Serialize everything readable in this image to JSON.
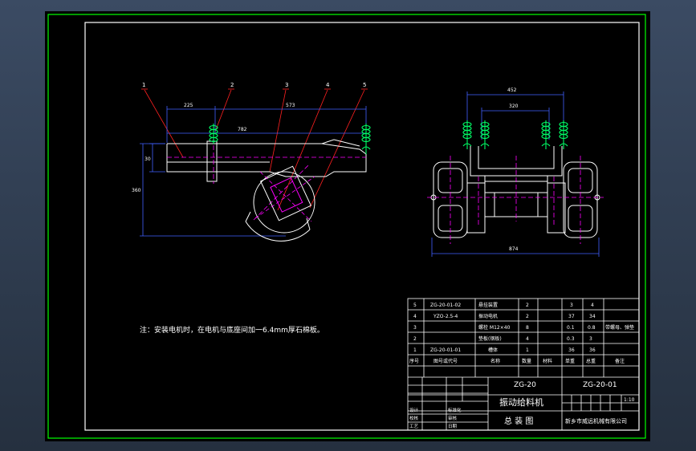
{
  "colors": {
    "background": "#000000",
    "frame_green": "#00ff00",
    "border_white": "#ffffff",
    "dimension_blue": "#4060ff",
    "leader_red": "#ff2020",
    "center_magenta": "#ff00ff",
    "spring_green": "#00ff66",
    "note_yellow": "#ffff00"
  },
  "drawing": {
    "side_view": {
      "part_labels": [
        "1",
        "2",
        "3",
        "4",
        "5"
      ],
      "dimensions": [
        "225",
        "573",
        "782",
        "30",
        "360"
      ]
    },
    "front_view": {
      "dimensions": [
        "452",
        "320",
        "874"
      ]
    },
    "note": "注：安装电机时，在电机与底座间加一6.4mm厚石棉板。"
  },
  "title_block": {
    "parts_rows": [
      {
        "seq": "5",
        "code": "ZG-20-01-02",
        "name": "悬挂装置",
        "qty": "2",
        "mat": "",
        "unit_w": "3",
        "total_w": "4",
        "remark": ""
      },
      {
        "seq": "4",
        "code": "YZO-2.5-4",
        "name": "振动电机",
        "qty": "2",
        "mat": "",
        "unit_w": "37",
        "total_w": "34",
        "remark": ""
      },
      {
        "seq": "3",
        "code": "",
        "name": "螺栓 M12×40",
        "qty": "8",
        "mat": "",
        "unit_w": "0.1",
        "total_w": "0.8",
        "remark": "带螺母、弹垫"
      },
      {
        "seq": "2",
        "code": "",
        "name": "垫板(钢板)",
        "qty": "4",
        "mat": "",
        "unit_w": "0.3",
        "total_w": "3",
        "remark": ""
      },
      {
        "seq": "1",
        "code": "ZG-20-01-01",
        "name": "槽体",
        "qty": "1",
        "mat": "",
        "unit_w": "36",
        "total_w": "36",
        "remark": ""
      }
    ],
    "header": [
      "序号",
      "图号或代号",
      "名称",
      "数量",
      "材料",
      "单重",
      "总重",
      "备注"
    ],
    "product_code": "ZG-20",
    "drawing_number": "ZG-20-01",
    "product_name": "振动给料机",
    "drawing_title": "总 装 图",
    "company": "新乡市威远机械有限公司",
    "sign_rows": [
      {
        "role": "设计",
        "right": "标准化"
      },
      {
        "role": "校核",
        "right": "审核"
      },
      {
        "role": "工艺",
        "right": "日期"
      }
    ],
    "scale": "1:10"
  }
}
